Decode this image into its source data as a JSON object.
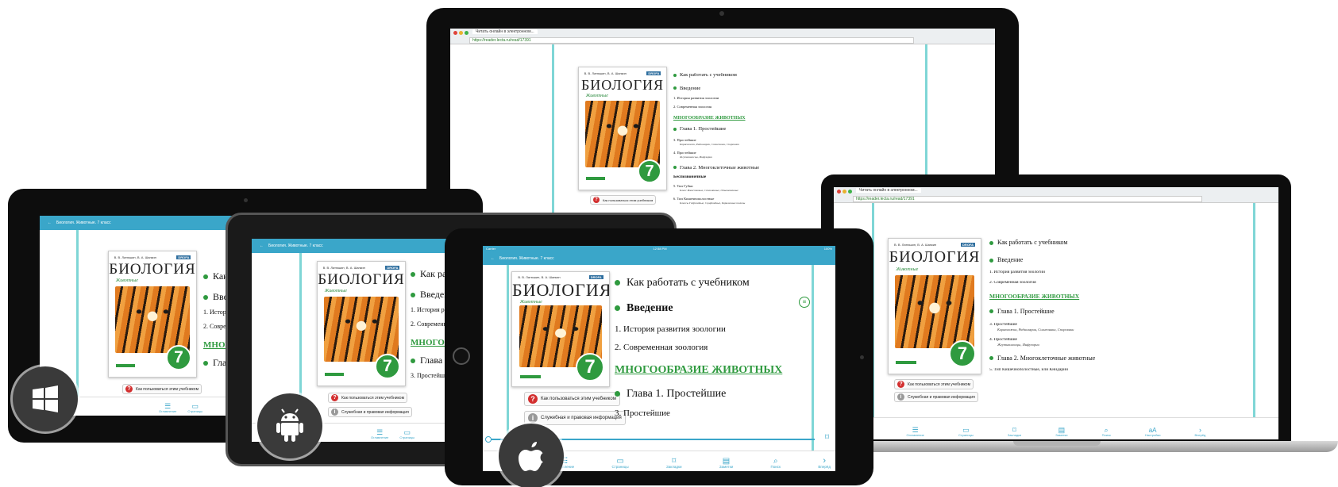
{
  "book": {
    "authors": "В. В. Латюшин, В. А. Шапкин",
    "brand": "DROFA",
    "title": "БИОЛОГИЯ",
    "subtitle": "Животные",
    "grade": "7"
  },
  "toc": {
    "how_to": "Как работать с учебником",
    "intro": "Введение",
    "ch_history": "1. История развития зоологии",
    "ch_modern": "2. Современная зоология",
    "diversity": "МНОГООБРАЗИЕ ЖИВОТНЫХ",
    "chapter1": "Глава 1. Простейшие",
    "protozoa": "3. Простейшие",
    "protozoa_sub": "Корненожки, Радиолярии, Солнечники, Споровики",
    "protozoa2": "4. Простейшие",
    "protozoa2_sub": "Жгутиконосцы, Инфузории",
    "chapter2": "Глава 2. Многоклеточные животные",
    "invertebrates": "Беспозвоночные",
    "sponges": "5. Тип Губки",
    "sponges_sub": "Класс Известковые, Стеклянные, Обыкновенные",
    "coelenterates": "6. Тип Кишечнополостные",
    "coelenterates_sub": "Классы Гидроидные, Сцифоидные, Коралловые полипы",
    "coel_short": "5. Тип Кишечнополостные, или Книдарии"
  },
  "help": {
    "how_to_use": "Как пользоваться этим учебником",
    "service": "Служебная и правовая информация"
  },
  "tablet_header": "Биология. Животные. 7 класс",
  "ipad_status": {
    "carrier": "Carrier",
    "time": "12:58 PM",
    "battery": "100%"
  },
  "browser": {
    "tab": "Читать онлайн в электронном...",
    "url": "https://reader.lecta.ru/read/17391"
  },
  "nav": {
    "contents": "Оглавление",
    "pages": "Страницы",
    "bookmarks": "Закладки",
    "notes": "Заметки",
    "search": "Поиск",
    "settings": "Настройки",
    "next": "Вперёд"
  },
  "os": {
    "windows": "windows-logo",
    "android": "android-logo",
    "apple": "apple-logo"
  },
  "colors": {
    "accent": "#3aa6c9",
    "green": "#2f9a3f",
    "teal_rule": "#7fd6d6",
    "device": "#0d0d0d"
  }
}
